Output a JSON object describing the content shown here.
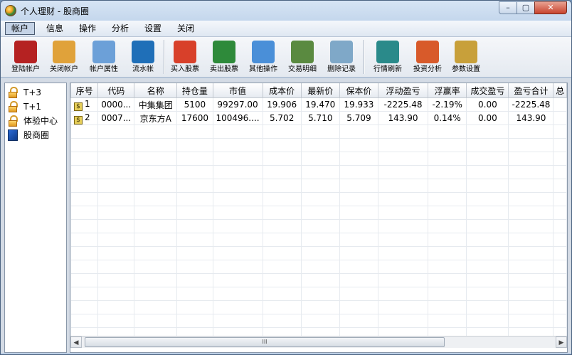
{
  "window": {
    "title": "个人理财 - 股商圈"
  },
  "window_controls": {
    "minimize": "–",
    "maximize": "▢",
    "close": "✕"
  },
  "menu": [
    {
      "label": "帐户",
      "active": true
    },
    {
      "label": "信息"
    },
    {
      "label": "操作"
    },
    {
      "label": "分析"
    },
    {
      "label": "设置"
    },
    {
      "label": "关闭"
    }
  ],
  "toolbar": [
    {
      "label": "登陆帐户",
      "icon": "bull-icon",
      "color": "#b52222"
    },
    {
      "label": "关闭帐户",
      "icon": "padlock-icon",
      "color": "#e0a23a"
    },
    {
      "label": "帐户属性",
      "icon": "properties-icon",
      "color": "#6ca0d8"
    },
    {
      "label": "流水帐",
      "icon": "ledger-book-icon",
      "color": "#1f6fb8"
    },
    {
      "label": "买入股票",
      "icon": "buy-globe-icon",
      "color": "#d8402a"
    },
    {
      "label": "卖出股票",
      "icon": "sell-globe-icon",
      "color": "#2e8a3a"
    },
    {
      "label": "其他操作",
      "icon": "other-ops-icon",
      "color": "#4a8fd8"
    },
    {
      "label": "交易明细",
      "icon": "magnifier-icon",
      "color": "#5a8a40"
    },
    {
      "label": "删除记录",
      "icon": "delete-record-icon",
      "color": "#7fa8c8"
    },
    {
      "label": "行情刷新",
      "icon": "refresh-globe-icon",
      "color": "#2a8a8a"
    },
    {
      "label": "投资分析",
      "icon": "pie-chart-icon",
      "color": "#d85a2a"
    },
    {
      "label": "参数设置",
      "icon": "settings-icon",
      "color": "#c8a03a"
    }
  ],
  "tree": [
    {
      "label": "T+3",
      "icon": "lock-icon"
    },
    {
      "label": "T+1",
      "icon": "lock-icon"
    },
    {
      "label": "体验中心",
      "icon": "lock-icon"
    },
    {
      "label": "股商圈",
      "icon": "board-icon"
    }
  ],
  "table": {
    "headers": [
      "序号",
      "代码",
      "名称",
      "持仓量",
      "市值",
      "成本价",
      "最新价",
      "保本价",
      "浮动盈亏",
      "浮赢率",
      "成交盈亏",
      "盈亏合计",
      "总"
    ],
    "rows": [
      [
        "1",
        "0000...",
        "中集集团",
        "5100",
        "99297.00",
        "19.906",
        "19.470",
        "19.933",
        "-2225.48",
        "-2.19%",
        "0.00",
        "-2225.48",
        ""
      ],
      [
        "2",
        "0007...",
        "京东方A",
        "17600",
        "100496....",
        "5.702",
        "5.710",
        "5.709",
        "143.90",
        "0.14%",
        "0.00",
        "143.90",
        ""
      ]
    ],
    "row_icon": "$"
  },
  "scrollbar": {
    "left": "◀",
    "right": "▶",
    "grip": "III"
  }
}
